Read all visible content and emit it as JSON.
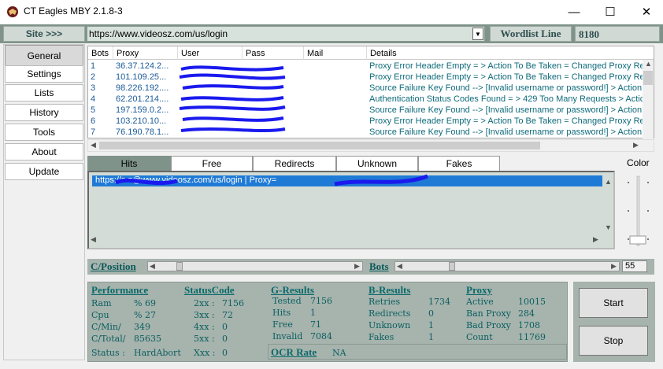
{
  "window": {
    "title": "CT Eagles MBY 2.1.8-3",
    "minimize": "—",
    "maximize": "☐",
    "close": "✕"
  },
  "sitebar": {
    "site_label": "Site >>>",
    "url": "https://www.videosz.com/us/login",
    "wordlist_label": "Wordlist Line",
    "wordlist_count": "8180"
  },
  "sidebar": {
    "items": [
      {
        "label": "General",
        "active": true
      },
      {
        "label": "Settings"
      },
      {
        "label": "Lists"
      },
      {
        "label": "History"
      },
      {
        "label": "Tools"
      },
      {
        "label": "About"
      },
      {
        "label": "Update"
      }
    ]
  },
  "table": {
    "headers": [
      "Bots",
      "Proxy",
      "User",
      "Pass",
      "Mail",
      "Details"
    ],
    "rows": [
      {
        "bot": "1",
        "proxy": "36.37.124.2...",
        "user": "",
        "pass": "",
        "details": "Proxy Error Header Empty = > Action To Be Taken = Changed Proxy Re"
      },
      {
        "bot": "2",
        "proxy": "101.109.25...",
        "user": "",
        "pass": "",
        "details": "Proxy Error Header Empty = > Action To Be Taken = Changed Proxy Re"
      },
      {
        "bot": "3",
        "proxy": "98.226.192....",
        "user": "",
        "pass": "",
        "details": "Source Failure Key Found --> [Invalid username or password!] > Action T"
      },
      {
        "bot": "4",
        "proxy": "62.201.214....",
        "user": "",
        "pass": "",
        "details": "Authentication Status Codes Found = > 429 Too Many Requests > Actic"
      },
      {
        "bot": "5",
        "proxy": "197.159.0.2...",
        "user": "",
        "pass": "",
        "details": "Source Failure Key Found --> [Invalid username or password!] > Action T"
      },
      {
        "bot": "6",
        "proxy": "103.210.10...",
        "user": "",
        "pass": "",
        "details": "Proxy Error Header Empty = > Action To Be Taken = Changed Proxy Re"
      },
      {
        "bot": "7",
        "proxy": "76.190.78.1...",
        "user": "",
        "pass": "",
        "details": "Source Failure Key Found --> [Invalid username or password!] > Action T"
      }
    ]
  },
  "tabs": {
    "items": [
      {
        "label": "Hits",
        "active": true
      },
      {
        "label": "Free"
      },
      {
        "label": "Redirects"
      },
      {
        "label": "Unknown"
      },
      {
        "label": "Fakes"
      }
    ],
    "color_label": "Color"
  },
  "hits": {
    "row_text": "https://s              z@www.videosz.com/us/login |  Proxy= "
  },
  "posbar": {
    "position_label": "C/Position",
    "bots_label": "Bots",
    "bots_value": "55"
  },
  "stats": {
    "performance": {
      "header": "Performance",
      "ram_label": "Ram",
      "ram_value": "% 69",
      "cpu_label": "Cpu",
      "cpu_value": "% 27",
      "cmin_label": "C/Min/",
      "cmin_value": "349",
      "ctotal_label": "C/Total/",
      "ctotal_value": "85635",
      "status_label": "Status :",
      "status_value": "HardAbort"
    },
    "status_code": {
      "header": "StatusCode",
      "c2xx_label": "2xx :",
      "c2xx_value": "7156",
      "c3xx_label": "3xx :",
      "c3xx_value": "72",
      "c4xx_label": "4xx :",
      "c4xx_value": "0",
      "c5xx_label": "5xx :",
      "c5xx_value": "0",
      "cxxx_label": "Xxx :",
      "cxxx_value": "0"
    },
    "g_results": {
      "header": "G-Results",
      "tested_label": "Tested",
      "tested_value": "7156",
      "hits_label": "Hits",
      "hits_value": "1",
      "free_label": "Free",
      "free_value": "71",
      "invalid_label": "Invalid",
      "invalid_value": "7084",
      "ocr_label": "OCR Rate",
      "ocr_value": "NA"
    },
    "b_results": {
      "header": "B-Results",
      "retries_label": "Retries",
      "retries_value": "1734",
      "redirects_label": "Redirects",
      "redirects_value": "0",
      "unknown_label": "Unknown",
      "unknown_value": "1",
      "fakes_label": "Fakes",
      "fakes_value": "1"
    },
    "proxy": {
      "header": "Proxy",
      "active_label": "Active",
      "active_value": "10015",
      "ban_label": "Ban Proxy",
      "ban_value": "284",
      "bad_label": "Bad Proxy",
      "bad_value": "1708",
      "count_label": "Count",
      "count_value": "11769"
    }
  },
  "actions": {
    "start_label": "Start",
    "stop_label": "Stop"
  },
  "colors": {
    "panel": "#a7b3ad",
    "accent": "#7f938a",
    "selection": "#1f7ad6",
    "scribble": "#1a1aee"
  }
}
